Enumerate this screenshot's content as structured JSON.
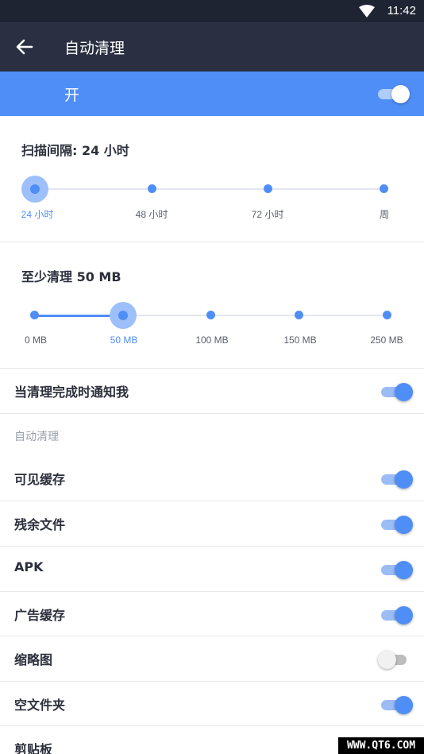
{
  "status_bar": {
    "time": "11:42",
    "wifi_icon": "wifi-icon"
  },
  "app_bar": {
    "title": "自动清理",
    "back_icon": "arrow-left-icon"
  },
  "master": {
    "label": "开",
    "enabled": true
  },
  "scan_interval": {
    "title": "扫描间隔:  24 小时",
    "options": [
      "24 小时",
      "48 小时",
      "72 小时",
      "周"
    ],
    "selected_index": 0
  },
  "min_clean": {
    "title": "至少清理 50 MB",
    "options": [
      "0 MB",
      "50 MB",
      "100 MB",
      "150 MB",
      "250 MB"
    ],
    "selected_index": 1
  },
  "notify": {
    "label": "当清理完成时通知我",
    "enabled": true
  },
  "auto_clean": {
    "header": "自动清理",
    "items": [
      {
        "label": "可见缓存",
        "enabled": true
      },
      {
        "label": "残余文件",
        "enabled": true
      },
      {
        "label": "APK",
        "enabled": true
      },
      {
        "label": "广告缓存",
        "enabled": true
      },
      {
        "label": "缩略图",
        "enabled": false
      },
      {
        "label": "空文件夹",
        "enabled": true
      },
      {
        "label": "剪贴板",
        "enabled": null
      }
    ]
  },
  "watermark": "WWW.QT6.COM",
  "colors": {
    "accent": "#4f8ef7",
    "app_bar": "#2a3042",
    "status_bar": "#1f2433"
  }
}
